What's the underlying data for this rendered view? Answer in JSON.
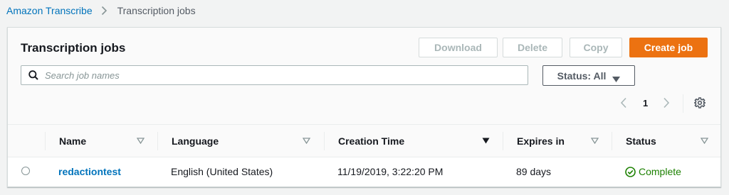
{
  "breadcrumb": {
    "service": "Amazon Transcribe",
    "current": "Transcription jobs"
  },
  "panel": {
    "title": "Transcription jobs",
    "buttons": {
      "download": "Download",
      "delete": "Delete",
      "copy": "Copy",
      "create": "Create job"
    },
    "search_placeholder": "Search job names",
    "status_filter": "Status: All",
    "pagination": {
      "current_page": "1"
    }
  },
  "table": {
    "columns": [
      "Name",
      "Language",
      "Creation Time",
      "Expires in",
      "Status"
    ],
    "rows": [
      {
        "name": "redactiontest",
        "language": "English (United States)",
        "creation_time": "11/19/2019, 3:22:20 PM",
        "expires_in": "89 days",
        "status": "Complete"
      }
    ]
  },
  "colors": {
    "accent_orange": "#ec7211",
    "link_blue": "#0073bb",
    "success_green": "#1d8102",
    "background": "#f2f3f3"
  },
  "icons": {
    "breadcrumb_separator": "chevron-right-icon",
    "search": "search-icon",
    "status_caret": "caret-down-icon",
    "prev_page": "chevron-left-icon",
    "next_page": "chevron-right-icon",
    "settings": "gear-icon",
    "sort_unsorted": "sort-triangle-outline-icon",
    "sort_active": "sort-triangle-filled-icon",
    "status_complete": "check-circle-icon"
  }
}
